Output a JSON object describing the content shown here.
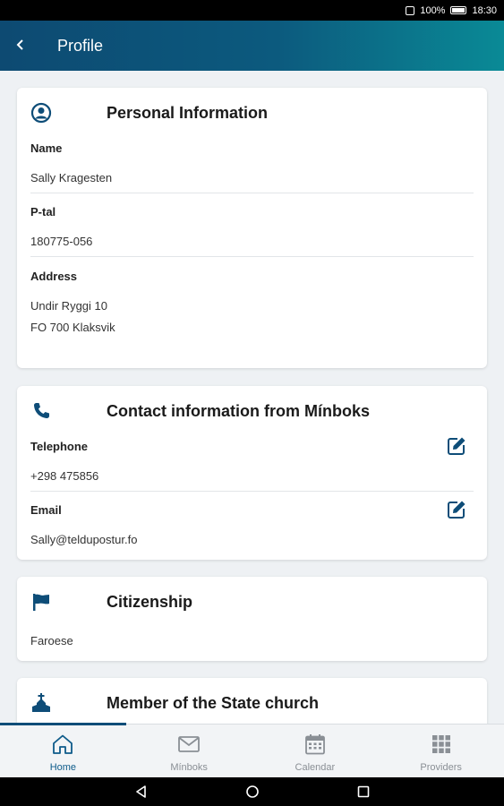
{
  "status_bar": {
    "battery": "100%",
    "time": "18:30"
  },
  "app_bar": {
    "title": "Profile"
  },
  "personal": {
    "title": "Personal Information",
    "name_label": "Name",
    "name_value": "Sally Kragesten",
    "ptal_label": "P-tal",
    "ptal_value": "180775-056",
    "address_label": "Address",
    "address_line1": "Undir Ryggi 10",
    "address_line2": "FO 700 Klaksvik"
  },
  "contact": {
    "title": "Contact information from Mínboks",
    "telephone_label": "Telephone",
    "telephone_value": "+298 475856",
    "email_label": "Email",
    "email_value": "Sally@teldupostur.fo"
  },
  "citizenship": {
    "title": "Citizenship",
    "value": "Faroese"
  },
  "church": {
    "title": "Member of the State church"
  },
  "bottom_nav": [
    {
      "label": "Home",
      "icon": "home-icon",
      "active": true
    },
    {
      "label": "Mínboks",
      "icon": "mail-icon",
      "active": false
    },
    {
      "label": "Calendar",
      "icon": "calendar-icon",
      "active": false
    },
    {
      "label": "Providers",
      "icon": "grid-icon",
      "active": false
    }
  ],
  "colors": {
    "primary": "#0e4d78",
    "appbar_start": "#0d4a72",
    "appbar_end": "#0a8a96",
    "background": "#eef1f4"
  }
}
